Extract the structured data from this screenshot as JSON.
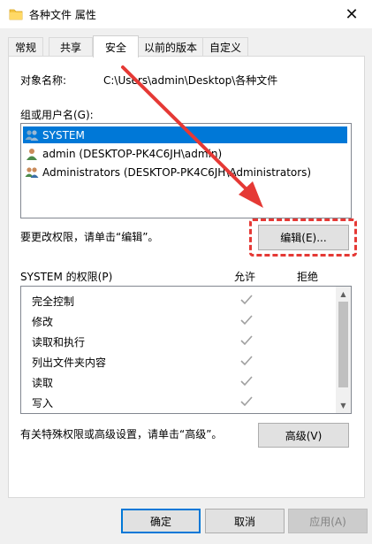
{
  "window": {
    "title": "各种文件 属性",
    "close_glyph": "✕"
  },
  "tabs": [
    {
      "label": "常规",
      "active": false
    },
    {
      "label": "共享",
      "active": false
    },
    {
      "label": "安全",
      "active": true
    },
    {
      "label": "以前的版本",
      "active": false
    },
    {
      "label": "自定义",
      "active": false
    }
  ],
  "security": {
    "object_label": "对象名称:",
    "object_path": "C:\\Users\\admin\\Desktop\\各种文件",
    "group_label": "组或用户名(G):",
    "users": [
      {
        "name": "SYSTEM",
        "selected": true,
        "icon": "users-group-icon"
      },
      {
        "name": "admin (DESKTOP-PK4C6JH\\admin)",
        "selected": false,
        "icon": "user-icon"
      },
      {
        "name": "Administrators (DESKTOP-PK4C6JH\\Administrators)",
        "selected": false,
        "icon": "users-group-icon"
      }
    ],
    "edit_hint": "要更改权限，请单击“编辑”。",
    "edit_button": "编辑(E)...",
    "permissions_label": "SYSTEM 的权限(P)",
    "allow_header": "允许",
    "deny_header": "拒绝",
    "permissions": [
      {
        "name": "完全控制",
        "allow": true,
        "deny": false
      },
      {
        "name": "修改",
        "allow": true,
        "deny": false
      },
      {
        "name": "读取和执行",
        "allow": true,
        "deny": false
      },
      {
        "name": "列出文件夹内容",
        "allow": true,
        "deny": false
      },
      {
        "name": "读取",
        "allow": true,
        "deny": false
      },
      {
        "name": "写入",
        "allow": true,
        "deny": false
      }
    ],
    "advanced_hint": "有关特殊权限或高级设置，请单击“高级”。",
    "advanced_button": "高级(V)"
  },
  "footer": {
    "ok": "确定",
    "cancel": "取消",
    "apply": "应用(A)"
  },
  "colors": {
    "selection": "#0078d7",
    "annotation": "#e53935",
    "check": "#a0a0a0"
  }
}
